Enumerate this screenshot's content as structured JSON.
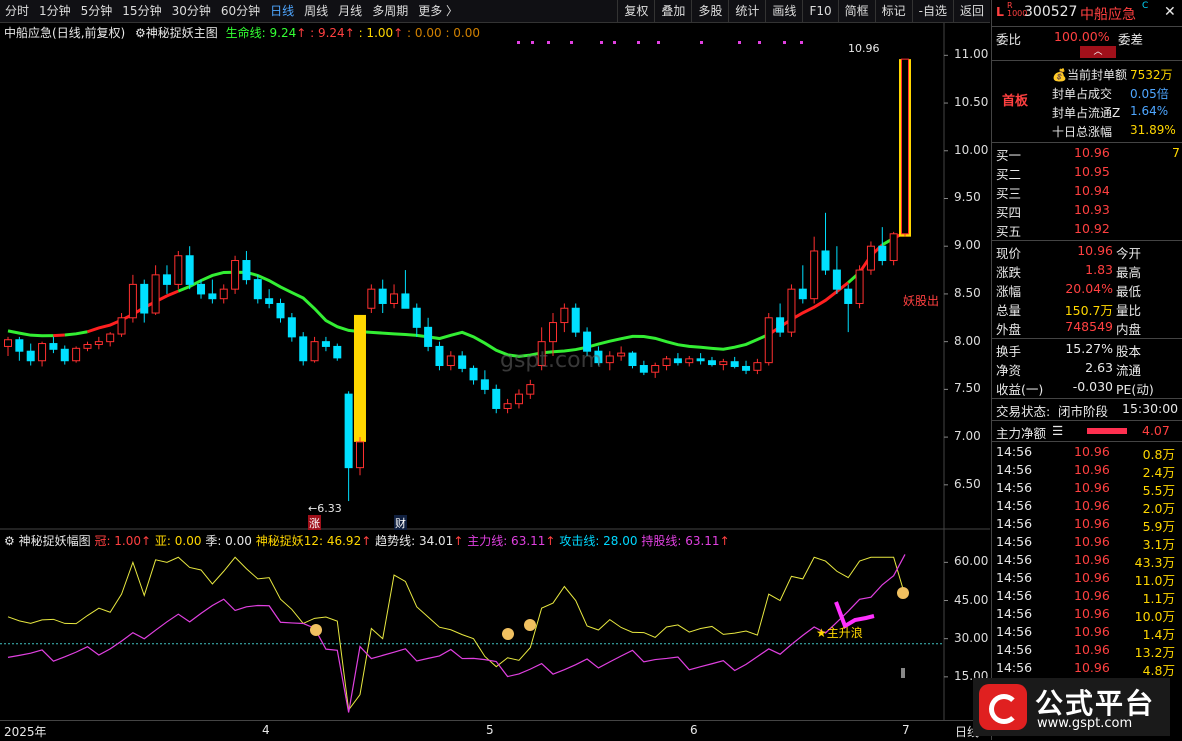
{
  "toolbar": {
    "periods": [
      "分时",
      "1分钟",
      "5分钟",
      "15分钟",
      "30分钟",
      "60分钟",
      "日线",
      "周线",
      "月线",
      "多周期",
      "更多 〉"
    ],
    "active_index": 6,
    "right_buttons": [
      "复权",
      "叠加",
      "多股",
      "统计",
      "画线",
      "F10",
      "简框",
      "标记",
      "-自选",
      "返回"
    ]
  },
  "main_header": {
    "stock": "中船应急",
    "mode": "(日线,前复权)",
    "indicator": "神秘捉妖主图",
    "life_line_label": "生命线: 9.24",
    "v2": ": 9.24",
    "v3": ": 1.00",
    "v4": ": 0.00 : 0.00"
  },
  "price_axis": [
    "11.00",
    "10.50",
    "10.00",
    "9.50",
    "9.00",
    "8.50",
    "8.00",
    "7.50",
    "7.00",
    "6.50"
  ],
  "annotations": {
    "high": "10.96",
    "low": "6.33",
    "zhang": "涨",
    "cai": "财",
    "yaogu": "妖股出"
  },
  "sub_header": {
    "name": "神秘捉妖幅图",
    "guan": "冠: 1.00",
    "ya": "亚: 0.00",
    "ji": "季: 0.00",
    "zy12": "神秘捉妖12: 46.92",
    "trend": "趋势线: 34.01",
    "main": "主力线: 63.11",
    "attack": "攻击线: 28.00",
    "hold": "持股线: 63.11"
  },
  "sub_axis": [
    "60.00",
    "45.00",
    "30.00",
    "15.00"
  ],
  "sub_annotation": "★主升浪",
  "x_axis": {
    "year": "2025年",
    "months": [
      "4",
      "5",
      "6",
      "7"
    ],
    "period": "日线"
  },
  "watermark": "gspt.com",
  "right_panel": {
    "code": "300527",
    "name": "中船应急",
    "weibi_label": "委比",
    "weibi_value": "100.00%",
    "weicha_label": "委差",
    "shouban": "首板",
    "seal": [
      {
        "label": "当前封单额",
        "value": "7532万"
      },
      {
        "label": "封单占成交",
        "value": "0.05倍"
      },
      {
        "label": "封单占流通Z",
        "value": "1.64%"
      },
      {
        "label": "十日总涨幅",
        "value": "31.89%"
      }
    ],
    "bids": [
      {
        "label": "买一",
        "price": "10.96",
        "vol": "7"
      },
      {
        "label": "买二",
        "price": "10.95",
        "vol": ""
      },
      {
        "label": "买三",
        "price": "10.94",
        "vol": ""
      },
      {
        "label": "买四",
        "price": "10.93",
        "vol": ""
      },
      {
        "label": "买五",
        "price": "10.92",
        "vol": ""
      }
    ],
    "quote": [
      {
        "l": "现价",
        "v": "10.96",
        "r": "今开"
      },
      {
        "l": "涨跌",
        "v": "1.83",
        "r": "最高"
      },
      {
        "l": "涨幅",
        "v": "20.04%",
        "r": "最低"
      },
      {
        "l": "总量",
        "v": "150.7万",
        "r": "量比"
      },
      {
        "l": "外盘",
        "v": "748549",
        "r": "内盘"
      }
    ],
    "quote2": [
      {
        "l": "换手",
        "v": "15.27%",
        "r": "股本"
      },
      {
        "l": "净资",
        "v": "2.63",
        "r": "流通"
      },
      {
        "l": "收益(一)",
        "v": "-0.030",
        "r": "PE(动)"
      }
    ],
    "status_label": "交易状态:",
    "status_value": "闭市阶段",
    "status_time": "15:30:00",
    "zljl_label": "主力净额",
    "zljl_value": "4.07",
    "ticks": [
      {
        "t": "14:56",
        "p": "10.96",
        "v": "0.8万"
      },
      {
        "t": "14:56",
        "p": "10.96",
        "v": "2.4万"
      },
      {
        "t": "14:56",
        "p": "10.96",
        "v": "5.5万"
      },
      {
        "t": "14:56",
        "p": "10.96",
        "v": "2.0万"
      },
      {
        "t": "14:56",
        "p": "10.96",
        "v": "5.9万"
      },
      {
        "t": "14:56",
        "p": "10.96",
        "v": "3.1万"
      },
      {
        "t": "14:56",
        "p": "10.96",
        "v": "43.3万"
      },
      {
        "t": "14:56",
        "p": "10.96",
        "v": "11.0万"
      },
      {
        "t": "14:56",
        "p": "10.96",
        "v": "1.1万"
      },
      {
        "t": "14:56",
        "p": "10.96",
        "v": "10.0万"
      },
      {
        "t": "14:56",
        "p": "10.96",
        "v": "1.4万"
      },
      {
        "t": "14:56",
        "p": "10.96",
        "v": "13.2万"
      },
      {
        "t": "14:56",
        "p": "10.96",
        "v": "4.8万"
      }
    ]
  },
  "logo": {
    "text": "公式平台",
    "url": "www.gspt.com"
  },
  "colors": {
    "up": "#ff3030",
    "down": "#00e0ff",
    "life": "#33ee33",
    "life_up": "#ff2020",
    "gold": "#ffd700",
    "trend": "#e8e840",
    "main_line": "#e040e0"
  },
  "chart_data": {
    "type": "candlestick",
    "ylim": [
      6.1,
      11.15
    ],
    "candles": [
      [
        7.95,
        8.05,
        7.85,
        8.02
      ],
      [
        8.02,
        8.05,
        7.8,
        7.9
      ],
      [
        7.9,
        7.98,
        7.75,
        7.8
      ],
      [
        7.8,
        8.0,
        7.74,
        7.98
      ],
      [
        7.98,
        8.05,
        7.88,
        7.92
      ],
      [
        7.92,
        7.96,
        7.76,
        7.8
      ],
      [
        7.8,
        7.95,
        7.78,
        7.93
      ],
      [
        7.93,
        8.0,
        7.9,
        7.97
      ],
      [
        7.97,
        8.05,
        7.92,
        8.0
      ],
      [
        8.0,
        8.1,
        7.95,
        8.08
      ],
      [
        8.08,
        8.3,
        8.05,
        8.25
      ],
      [
        8.25,
        8.7,
        8.2,
        8.6
      ],
      [
        8.6,
        8.65,
        8.2,
        8.3
      ],
      [
        8.3,
        8.8,
        8.28,
        8.7
      ],
      [
        8.7,
        8.8,
        8.5,
        8.6
      ],
      [
        8.6,
        8.95,
        8.55,
        8.9
      ],
      [
        8.9,
        9.0,
        8.55,
        8.6
      ],
      [
        8.6,
        8.65,
        8.45,
        8.5
      ],
      [
        8.5,
        8.65,
        8.4,
        8.45
      ],
      [
        8.45,
        8.6,
        8.4,
        8.55
      ],
      [
        8.55,
        8.9,
        8.5,
        8.85
      ],
      [
        8.85,
        8.95,
        8.6,
        8.65
      ],
      [
        8.65,
        8.7,
        8.4,
        8.45
      ],
      [
        8.45,
        8.55,
        8.35,
        8.4
      ],
      [
        8.4,
        8.45,
        8.2,
        8.25
      ],
      [
        8.25,
        8.3,
        8.0,
        8.05
      ],
      [
        8.05,
        8.1,
        7.75,
        7.8
      ],
      [
        7.8,
        8.05,
        7.78,
        8.0
      ],
      [
        8.0,
        8.05,
        7.9,
        7.95
      ],
      [
        7.95,
        7.98,
        7.8,
        7.83
      ],
      [
        7.45,
        7.48,
        6.33,
        6.68
      ],
      [
        6.68,
        7.0,
        6.6,
        6.95
      ],
      [
        8.35,
        8.6,
        8.3,
        8.55
      ],
      [
        8.55,
        8.65,
        8.3,
        8.4
      ],
      [
        8.4,
        8.6,
        8.35,
        8.5
      ],
      [
        8.5,
        8.75,
        8.4,
        8.35
      ],
      [
        8.35,
        8.4,
        8.05,
        8.15
      ],
      [
        8.15,
        8.25,
        7.9,
        7.95
      ],
      [
        7.95,
        8.0,
        7.7,
        7.75
      ],
      [
        7.75,
        7.9,
        7.7,
        7.85
      ],
      [
        7.85,
        7.9,
        7.68,
        7.72
      ],
      [
        7.72,
        7.75,
        7.55,
        7.6
      ],
      [
        7.6,
        7.7,
        7.45,
        7.5
      ],
      [
        7.5,
        7.55,
        7.25,
        7.3
      ],
      [
        7.3,
        7.4,
        7.25,
        7.35
      ],
      [
        7.35,
        7.5,
        7.3,
        7.45
      ],
      [
        7.45,
        7.6,
        7.4,
        7.55
      ],
      [
        7.75,
        8.15,
        7.7,
        8.0
      ],
      [
        8.0,
        8.3,
        7.85,
        8.2
      ],
      [
        8.2,
        8.4,
        8.1,
        8.35
      ],
      [
        8.35,
        8.4,
        8.05,
        8.1
      ],
      [
        8.1,
        8.15,
        7.85,
        7.9
      ],
      [
        7.9,
        7.95,
        7.75,
        7.78
      ],
      [
        7.78,
        7.9,
        7.7,
        7.85
      ],
      [
        7.85,
        7.95,
        7.8,
        7.88
      ],
      [
        7.88,
        7.9,
        7.72,
        7.75
      ],
      [
        7.75,
        7.8,
        7.65,
        7.68
      ],
      [
        7.68,
        7.78,
        7.62,
        7.75
      ],
      [
        7.75,
        7.85,
        7.7,
        7.82
      ],
      [
        7.82,
        7.88,
        7.75,
        7.78
      ],
      [
        7.78,
        7.85,
        7.74,
        7.82
      ],
      [
        7.82,
        7.88,
        7.76,
        7.8
      ],
      [
        7.8,
        7.84,
        7.74,
        7.76
      ],
      [
        7.76,
        7.82,
        7.7,
        7.79
      ],
      [
        7.79,
        7.84,
        7.72,
        7.74
      ],
      [
        7.74,
        7.8,
        7.66,
        7.7
      ],
      [
        7.7,
        7.82,
        7.66,
        7.78
      ],
      [
        7.78,
        8.3,
        7.75,
        8.25
      ],
      [
        8.25,
        8.4,
        8.05,
        8.1
      ],
      [
        8.1,
        8.6,
        8.05,
        8.55
      ],
      [
        8.55,
        8.8,
        8.4,
        8.45
      ],
      [
        8.45,
        9.1,
        8.4,
        8.95
      ],
      [
        8.95,
        9.35,
        8.7,
        8.75
      ],
      [
        8.75,
        9.0,
        8.5,
        8.55
      ],
      [
        8.55,
        8.6,
        8.1,
        8.4
      ],
      [
        8.4,
        8.8,
        8.35,
        8.75
      ],
      [
        8.75,
        9.05,
        8.7,
        9.0
      ],
      [
        9.0,
        9.2,
        8.8,
        8.85
      ],
      [
        8.85,
        9.15,
        8.8,
        9.13
      ],
      [
        9.13,
        10.96,
        9.1,
        10.96
      ]
    ],
    "gold_bars": [
      {
        "index": 31,
        "from": 6.95,
        "to": 8.28
      },
      {
        "index": 79,
        "from": 9.1,
        "to": 10.96
      }
    ]
  }
}
